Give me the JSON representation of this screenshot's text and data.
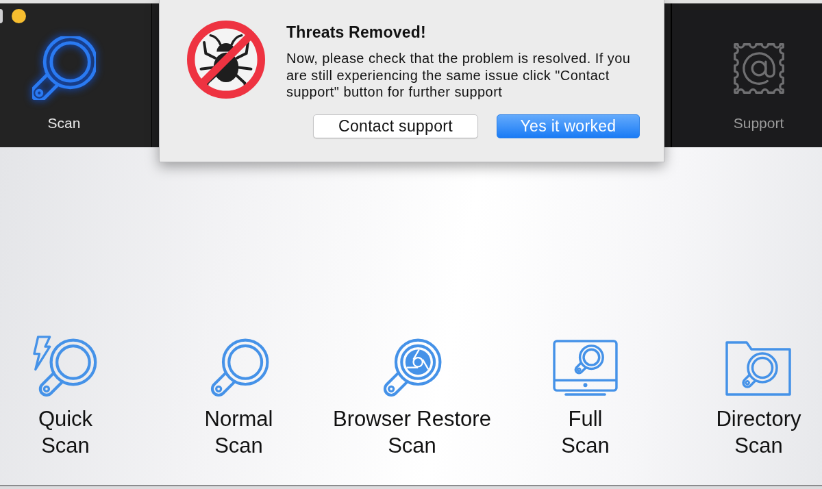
{
  "toolbar": {
    "tabs": [
      {
        "label": "Scan",
        "selected": true
      },
      {
        "label": "Support",
        "selected": false
      }
    ]
  },
  "dialog": {
    "title": "Threats Removed!",
    "message": "Now, please check that the problem is resolved. If you are still experiencing the same issue click \"Contact support\" button for further support",
    "buttons": [
      {
        "label": "Contact support",
        "default": false
      },
      {
        "label": "Yes it worked",
        "default": true
      }
    ]
  },
  "scan_options": [
    {
      "label_lines": [
        "Quick",
        "Scan"
      ]
    },
    {
      "label_lines": [
        "Normal",
        "Scan"
      ]
    },
    {
      "label_lines": [
        "Browser Restore",
        "Scan"
      ]
    },
    {
      "label_lines": [
        "Full",
        "Scan"
      ]
    },
    {
      "label_lines": [
        "Directory",
        "Scan"
      ]
    }
  ]
}
